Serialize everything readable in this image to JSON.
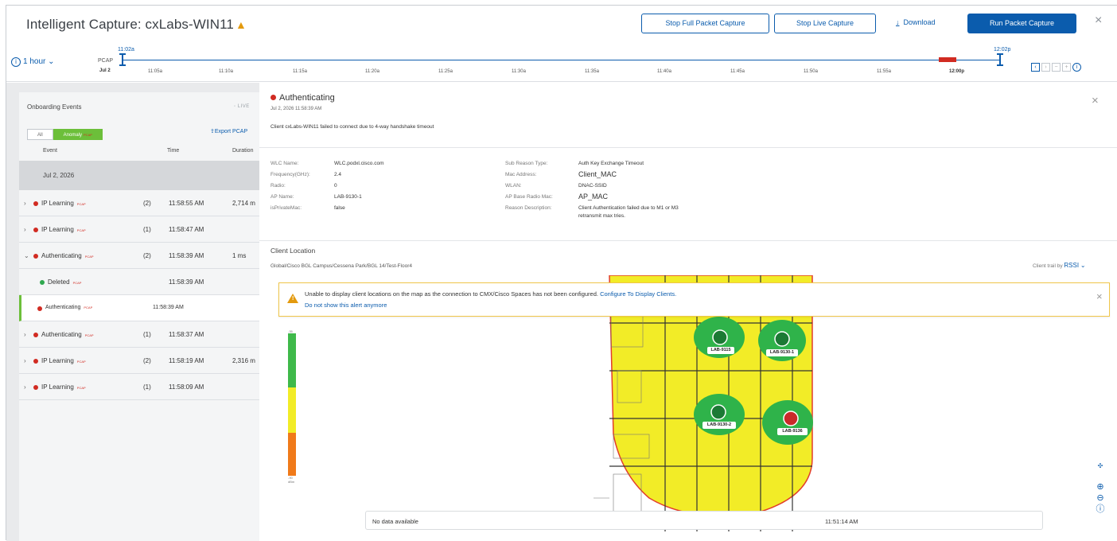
{
  "header": {
    "title": "Intelligent Capture: cxLabs-WIN11",
    "warn_icon": "warning-triangle-icon",
    "btn_stop_full": "Stop Full Packet Capture",
    "btn_stop_live": "Stop Live Capture",
    "btn_download": "Download",
    "btn_run": "Run Packet Capture",
    "accent": "#0b5cad"
  },
  "timeline": {
    "range": "1 hour",
    "pcap_label": "PCAP",
    "date": "Jul 2",
    "start_time": "11:02a",
    "end_time": "12:02p",
    "ticks": [
      "11:05a",
      "11:10a",
      "11:15a",
      "11:20a",
      "11:25a",
      "11:30a",
      "11:35a",
      "11:40a",
      "11:45a",
      "11:50a",
      "11:55a",
      "12:00p"
    ]
  },
  "events_panel": {
    "title": "Onboarding Events",
    "live": "LIVE",
    "filter_all": "All",
    "filter_anomaly": "Anomaly",
    "pcap_tag": "PCAP",
    "export": "Export PCAP",
    "col_event": "Event",
    "col_time": "Time",
    "col_duration": "Duration",
    "date_group": "Jul 2, 2026",
    "rows": [
      {
        "name": "IP Learning",
        "count": "(2)",
        "time": "11:58:55 AM",
        "duration": "2,714 m",
        "dot": "#d12b22",
        "chev": "›"
      },
      {
        "name": "IP Learning",
        "count": "(1)",
        "time": "11:58:47 AM",
        "duration": "",
        "dot": "#d12b22",
        "chev": "›"
      },
      {
        "name": "Authenticating",
        "count": "(2)",
        "time": "11:58:39 AM",
        "duration": "1 ms",
        "dot": "#d12b22",
        "chev": "⌄"
      },
      {
        "name": "Deleted",
        "count": "",
        "time": "11:58:39 AM",
        "duration": "",
        "dot": "#2fa84f",
        "chev": ""
      },
      {
        "name": "Authenticating",
        "count": "",
        "time": "11:58:39 AM",
        "duration": "",
        "dot": "#d12b22",
        "chev": ""
      },
      {
        "name": "Authenticating",
        "count": "(1)",
        "time": "11:58:37 AM",
        "duration": "",
        "dot": "#d12b22",
        "chev": "›"
      },
      {
        "name": "IP Learning",
        "count": "(2)",
        "time": "11:58:19 AM",
        "duration": "2,316 m",
        "dot": "#d12b22",
        "chev": "›"
      },
      {
        "name": "IP Learning",
        "count": "(1)",
        "time": "11:58:09 AM",
        "duration": "",
        "dot": "#d12b22",
        "chev": "›"
      }
    ]
  },
  "detail": {
    "title": "Authenticating",
    "date": "Jul 2, 2026 11:58:39 AM",
    "description": "Client cxLabs-WIN11 failed to connect due to 4-way handshake timeout",
    "left_fields": [
      {
        "k": "WLC Name:",
        "v": "WLC.podxl.cisco.com"
      },
      {
        "k": "Frequency(GHz):",
        "v": "2.4"
      },
      {
        "k": "Radio:",
        "v": "0"
      },
      {
        "k": "AP Name:",
        "v": "LAB-9130-1"
      },
      {
        "k": "isPrivateMac:",
        "v": "false"
      }
    ],
    "right_fields": [
      {
        "k": "Sub Reason Type:",
        "v": "Auth Key Exchange Timeout"
      },
      {
        "k": "Mac Address:",
        "v": "Client_MAC"
      },
      {
        "k": "WLAN:",
        "v": "DNAC-SSID"
      },
      {
        "k": "AP Base Radio Mac:",
        "v": "AP_MAC"
      },
      {
        "k": "Reason Description:",
        "v": "Client Authentication failed due to M1 or M3"
      },
      {
        "k": "",
        "v": "retransmit max tries."
      }
    ]
  },
  "location": {
    "title": "Client Location",
    "path": "Global/Cisco BGL Campus/Cessena Park/BGL 14/Test-Floor4",
    "trail_label": "Client trail by",
    "trail_value": "RSSI",
    "alert_text": "Unable to display client locations on the map as the connection to CMX/Cisco Spaces has not been configured.",
    "alert_link": "Configure To Display Clients.",
    "alert_hide": "Do not show this alert anymore",
    "no_data": "No data available",
    "no_data_time": "11:51:14 AM",
    "aps": [
      "LAB-9115",
      "LAB-9130-1",
      "LAB-9130-2",
      "LAB-9136"
    ],
    "legend_top": "-35",
    "legend_bottom": "-90",
    "legend_unit": "dBm"
  }
}
